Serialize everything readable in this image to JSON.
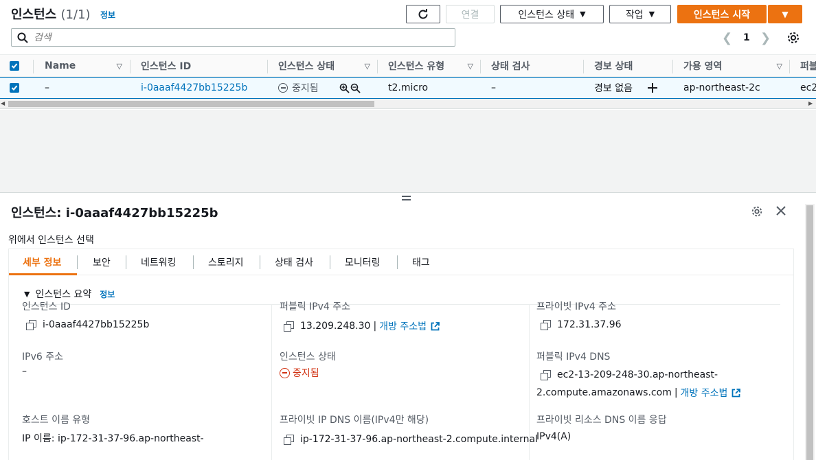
{
  "header": {
    "title": "인스턴스",
    "count": "(1/1)",
    "info": "정보",
    "buttons": {
      "refresh": "refresh-icon",
      "connect": "연결",
      "instance_state": "인스턴스 상태",
      "actions": "작업",
      "launch": "인스턴스 시작"
    }
  },
  "search": {
    "placeholder": "검색"
  },
  "pagination": {
    "page": "1"
  },
  "table": {
    "columns": [
      "Name",
      "인스턴스 ID",
      "인스턴스 상태",
      "인스턴스 유형",
      "상태 검사",
      "경보 상태",
      "가용 영역",
      "퍼블"
    ],
    "row": {
      "name": "–",
      "instance_id": "i-0aaaf4427bb15225b",
      "state": "중지됨",
      "type": "t2.micro",
      "status_check": "–",
      "alarm": "경보 없음",
      "az": "ap-northeast-2c",
      "public": "ec2"
    }
  },
  "split": {
    "title": "인스턴스: i-0aaaf4427bb15225b",
    "subtitle": "위에서 인스턴스 선택",
    "tabs": [
      "세부 정보",
      "보안",
      "네트워킹",
      "스토리지",
      "상태 검사",
      "모니터링",
      "태그"
    ],
    "summary": {
      "heading": "인스턴스 요약",
      "info": "정보"
    },
    "fields": {
      "instance_id_label": "인스턴스 ID",
      "instance_id": "i-0aaaf4427bb15225b",
      "public_ipv4_label": "퍼블릭 IPv4 주소",
      "public_ipv4": "13.209.248.30",
      "open_address": "개방 주소법",
      "separator": "|",
      "private_ipv4_label": "프라이빗 IPv4 주소",
      "private_ipv4": "172.31.37.96",
      "ipv6_label": "IPv6 주소",
      "ipv6": "–",
      "state_label": "인스턴스 상태",
      "state": "중지됨",
      "public_dns_label": "퍼블릭 IPv4 DNS",
      "public_dns_line1": "ec2-13-209-248-30.ap-northeast-",
      "public_dns_line2": "2.compute.amazonaws.com",
      "hostname_type_label": "호스트 이름 유형",
      "hostname_type": "IP 이름: ip-172-31-37-96.ap-northeast-",
      "private_dns_label": "프라이빗 IP DNS 이름(IPv4만 해당)",
      "private_dns": "ip-172-31-37-96.ap-northeast-2.compute.internal",
      "private_resource_dns_label": "프라이빗 리소스 DNS 이름 응답",
      "private_resource_dns": "IPv4(A)"
    }
  },
  "colors": {
    "accent": "#ec7211",
    "link": "#0073bb",
    "stopped": "#d13212",
    "selected_row": "#f1faff"
  }
}
